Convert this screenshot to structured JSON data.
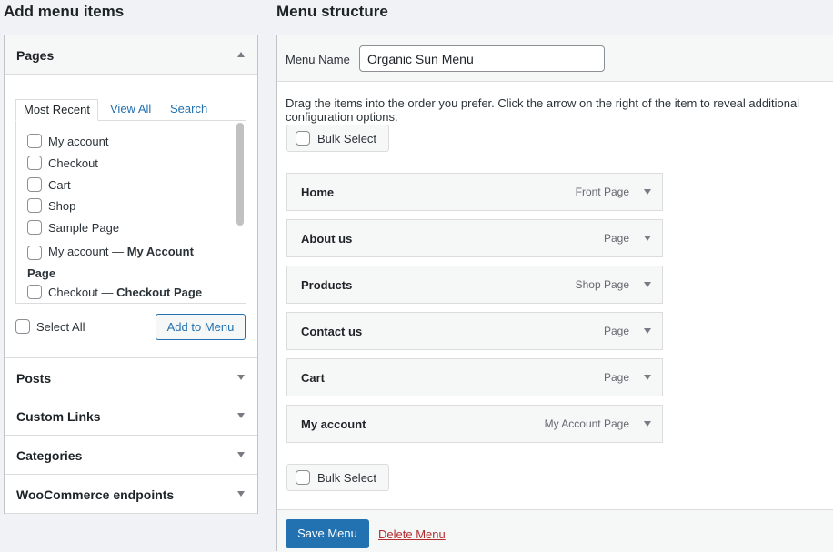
{
  "left": {
    "title": "Add menu items",
    "pages": {
      "title": "Pages",
      "tabs": [
        "Most Recent",
        "View All",
        "Search"
      ],
      "items": [
        {
          "label": "My account"
        },
        {
          "label": "Checkout"
        },
        {
          "label": "Cart"
        },
        {
          "label": "Shop"
        },
        {
          "label": "Sample Page"
        },
        {
          "label": "My account — ",
          "bold": "My Account Page"
        },
        {
          "label": "Checkout — ",
          "bold": "Checkout Page"
        }
      ],
      "select_all": "Select All",
      "add_button": "Add to Menu"
    },
    "sections": [
      "Posts",
      "Custom Links",
      "Categories",
      "WooCommerce endpoints"
    ]
  },
  "right": {
    "title": "Menu structure",
    "menu_name_label": "Menu Name",
    "menu_name_value": "Organic Sun Menu",
    "instructions": "Drag the items into the order you prefer. Click the arrow on the right of the item to reveal additional configuration options.",
    "bulk_select": "Bulk Select",
    "items": [
      {
        "name": "Home",
        "type": "Front Page"
      },
      {
        "name": "About us",
        "type": "Page"
      },
      {
        "name": "Products",
        "type": "Shop Page"
      },
      {
        "name": "Contact us",
        "type": "Page"
      },
      {
        "name": "Cart",
        "type": "Page"
      },
      {
        "name": "My account",
        "type": "My Account Page"
      }
    ],
    "save": "Save Menu",
    "delete": "Delete Menu"
  },
  "colors": {
    "primary": "#2271b1",
    "danger": "#b32d2e"
  }
}
